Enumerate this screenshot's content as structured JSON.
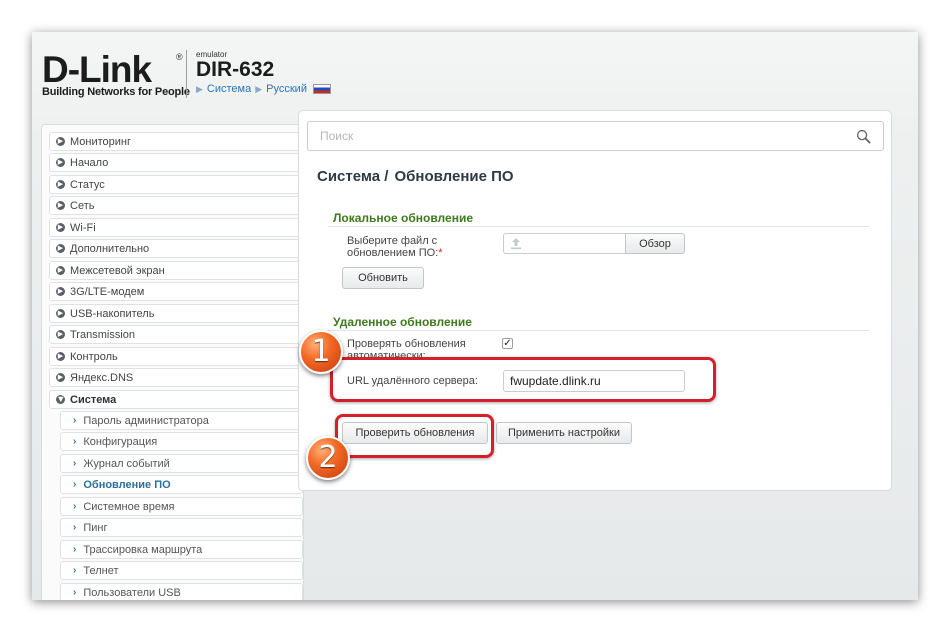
{
  "header": {
    "logo_text": "D-Link",
    "logo_reg": "®",
    "logo_tagline": "Building Networks for People",
    "emulator_label": "emulator",
    "model": "DIR-632",
    "breadcrumb": [
      "Система",
      "Русский"
    ]
  },
  "sidebar": {
    "items": [
      {
        "label": "Мониторинг"
      },
      {
        "label": "Начало"
      },
      {
        "label": "Статус"
      },
      {
        "label": "Сеть"
      },
      {
        "label": "Wi-Fi"
      },
      {
        "label": "Дополнительно"
      },
      {
        "label": "Межсетевой экран"
      },
      {
        "label": "3G/LTE-модем"
      },
      {
        "label": "USB-накопитель"
      },
      {
        "label": "Transmission"
      },
      {
        "label": "Контроль"
      },
      {
        "label": "Яндекс.DNS"
      },
      {
        "label": "Система",
        "expanded": true
      }
    ],
    "subitems": [
      {
        "label": "Пароль администратора"
      },
      {
        "label": "Конфигурация"
      },
      {
        "label": "Журнал событий"
      },
      {
        "label": "Обновление ПО",
        "active": true
      },
      {
        "label": "Системное время"
      },
      {
        "label": "Пинг"
      },
      {
        "label": "Трассировка маршрута"
      },
      {
        "label": "Телнет"
      },
      {
        "label": "Пользователи USB"
      }
    ]
  },
  "search": {
    "placeholder": "Поиск"
  },
  "main": {
    "title_part1": "Система /",
    "title_part2": "Обновление ПО",
    "local": {
      "section_title": "Локальное обновление",
      "file_label_line1": "Выберите файл с",
      "file_label_line2": "обновлением ПО:",
      "required_mark": "*",
      "browse_label": "Обзор",
      "update_label": "Обновить"
    },
    "remote": {
      "section_title": "Удаленное обновление",
      "auto_check_label_line1": "Проверять обновления",
      "auto_check_label_line2": "автоматически:",
      "auto_check_checked": true,
      "checkmark": "✓",
      "url_label": "URL удалённого сервера:",
      "url_value": "fwupdate.dlink.ru",
      "check_button_label": "Проверить обновления",
      "apply_button_label": "Применить настройки"
    }
  },
  "annotations": {
    "badge_1": "1",
    "badge_2": "2",
    "highlight_color": "#d4202a",
    "badge_color": "#f26a25"
  },
  "colors": {
    "section_title": "#3e7a1e",
    "link": "#2a76b8",
    "active_menu": "#2d6e9c"
  }
}
